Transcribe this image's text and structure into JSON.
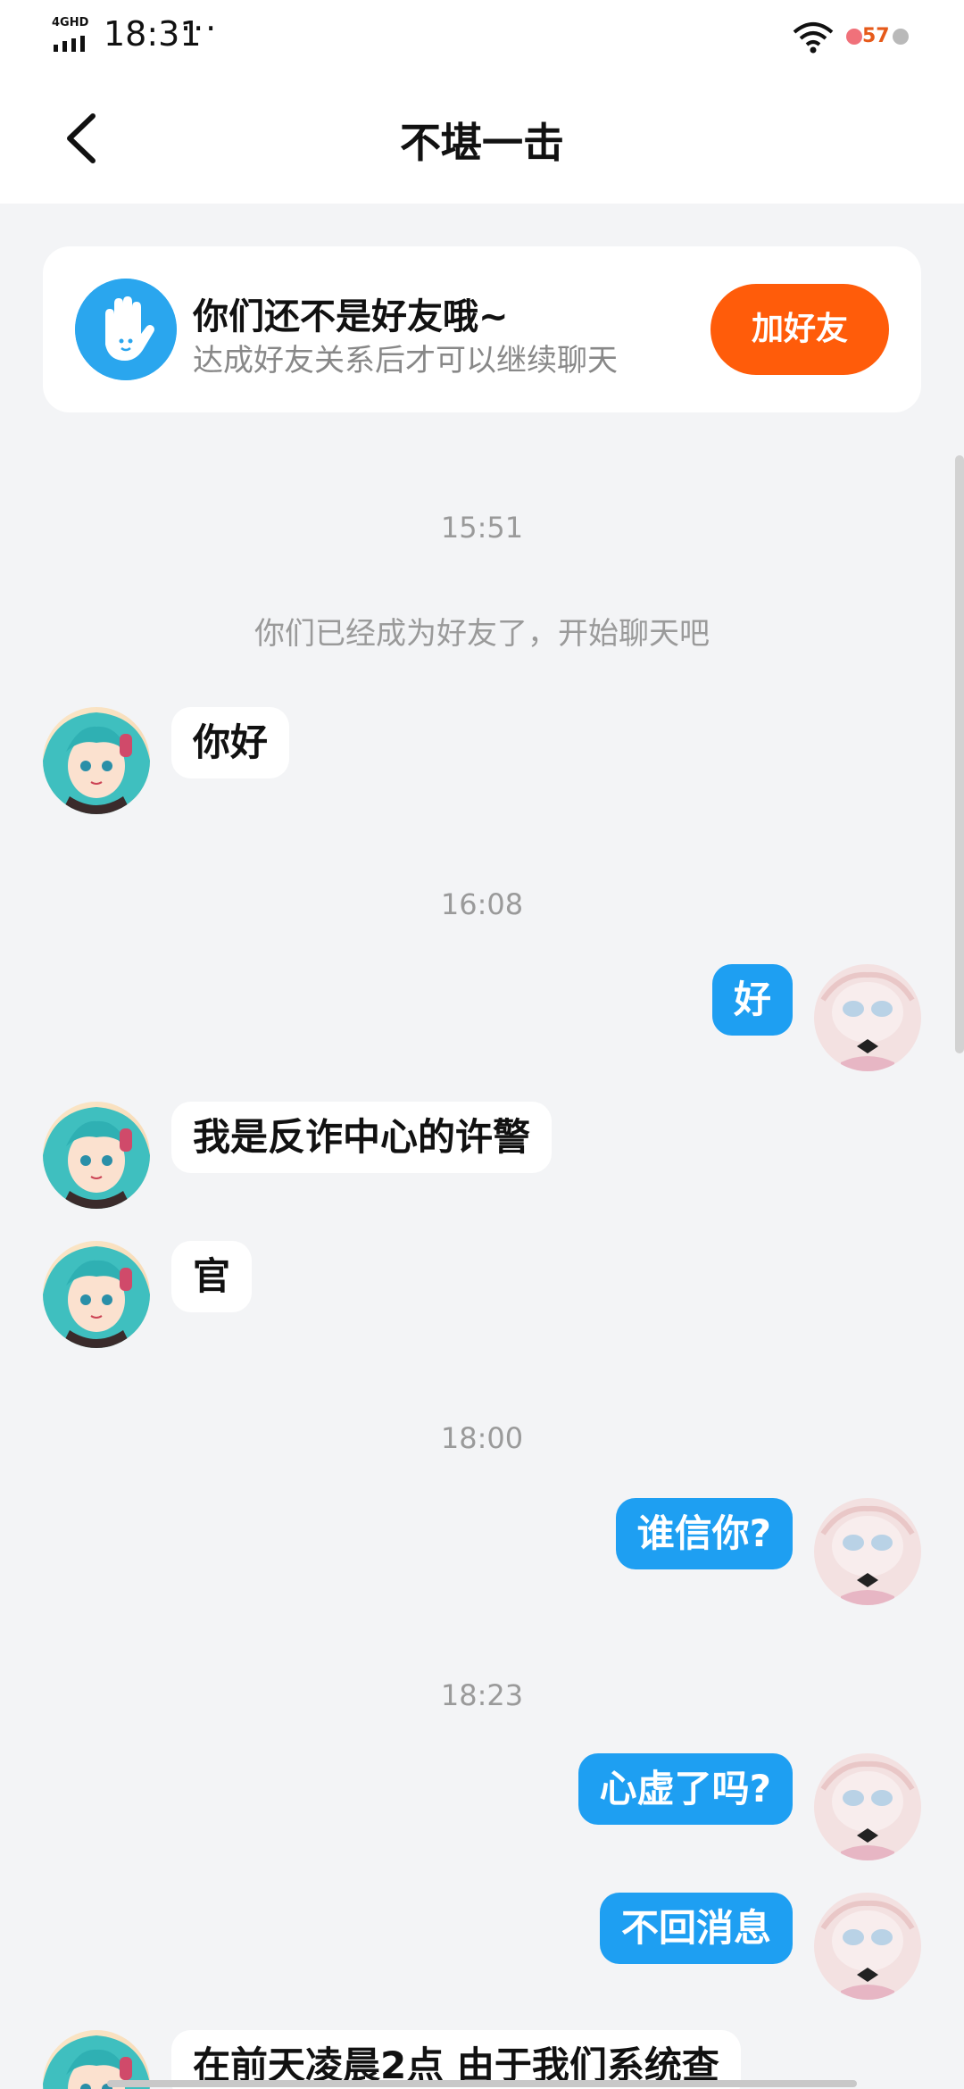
{
  "status_bar": {
    "network": "4GHD",
    "time": "18:31",
    "more": "···",
    "battery": "57"
  },
  "nav": {
    "title": "不堪一击"
  },
  "friend_card": {
    "title": "你们还不是好友哦~",
    "subtitle": "达成好友关系后才可以继续聊天",
    "button_label": "加好友"
  },
  "messages": {
    "t1": "15:51",
    "system": "你们已经成为好友了，开始聊天吧",
    "m1": "你好",
    "t2": "16:08",
    "m2": "好",
    "m3": "我是反诈中心的许警",
    "m4": "官",
    "t3": "18:00",
    "m5": "谁信你?",
    "t4": "18:23",
    "m6": "心虚了吗?",
    "m7": "不回消息",
    "m8": "在前天凌晨2点 由于我们系统查"
  },
  "colors": {
    "accent_orange": "#ff5c0a",
    "bubble_blue": "#1e9ff2",
    "background": "#f3f4f6"
  }
}
